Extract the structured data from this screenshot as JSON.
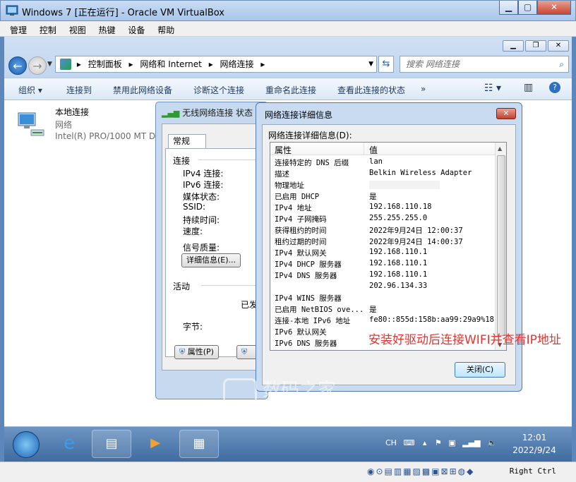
{
  "vm": {
    "title": "Windows 7 [正在运行] - Oracle VM VirtualBox",
    "menu": [
      "管理",
      "控制",
      "视图",
      "热键",
      "设备",
      "帮助"
    ],
    "host_key": "Right Ctrl"
  },
  "explorer": {
    "breadcrumbs": [
      "控制面板",
      "网络和 Internet",
      "网络连接"
    ],
    "search_placeholder": "搜索 网络连接",
    "toolbar": [
      "组织 ▾",
      "连接到",
      "禁用此网络设备",
      "诊断这个连接",
      "重命名此连接",
      "查看此连接的状态",
      "»"
    ],
    "net_item": {
      "name": "本地连接",
      "status": "网络",
      "adapter": "Intel(R) PRO/1000 MT D"
    }
  },
  "status_dialog": {
    "title": "无线网络连接 状态",
    "tab": "常规",
    "section_connection": "连接",
    "fields": [
      "IPv4 连接:",
      "IPv6 连接:",
      "媒体状态:",
      "SSID:",
      "持续时间:",
      "速度:"
    ],
    "signal_label": "信号质量:",
    "details_button": "详细信息(E)...",
    "section_activity": "活动",
    "sent_partial": "已发",
    "bytes_label": "字节:",
    "properties_button": "属性(P)"
  },
  "details_dialog": {
    "title": "网络连接详细信息",
    "label": "网络连接详细信息(D):",
    "col_property": "属性",
    "col_value": "值",
    "rows": [
      {
        "p": "连接特定的 DNS 后缀",
        "v": "lan"
      },
      {
        "p": "描述",
        "v": "Belkin Wireless Adapter"
      },
      {
        "p": "物理地址",
        "v": ""
      },
      {
        "p": "已启用 DHCP",
        "v": "是"
      },
      {
        "p": "IPv4 地址",
        "v": "192.168.110.18"
      },
      {
        "p": "IPv4 子网掩码",
        "v": "255.255.255.0"
      },
      {
        "p": "获得租约的时间",
        "v": "2022年9月24日 12:00:37"
      },
      {
        "p": "租约过期的时间",
        "v": "2022年9月24日 14:00:37"
      },
      {
        "p": "IPv4 默认网关",
        "v": "192.168.110.1"
      },
      {
        "p": "IPv4 DHCP 服务器",
        "v": "192.168.110.1"
      },
      {
        "p": "IPv4 DNS 服务器",
        "v": "192.168.110.1"
      },
      {
        "p": "",
        "v": "202.96.134.33"
      },
      {
        "p": "IPv4 WINS 服务器",
        "v": ""
      },
      {
        "p": "已启用 NetBIOS ove...",
        "v": "是"
      },
      {
        "p": "连接-本地 IPv6 地址",
        "v": "fe80::855d:158b:aa99:29a9%18"
      },
      {
        "p": "IPv6 默认网关",
        "v": ""
      },
      {
        "p": "IPv6 DNS 服务器",
        "v": ""
      }
    ],
    "close_button": "关闭(C)"
  },
  "annotation": "安装好驱动后连接WIFI并查看IP地址",
  "watermark": {
    "main": "数码之家",
    "sub": "MYDIGIT.NET"
  },
  "taskbar": {
    "tray_lang": "CH",
    "clock_time": "12:01",
    "clock_date": "2022/9/24"
  }
}
